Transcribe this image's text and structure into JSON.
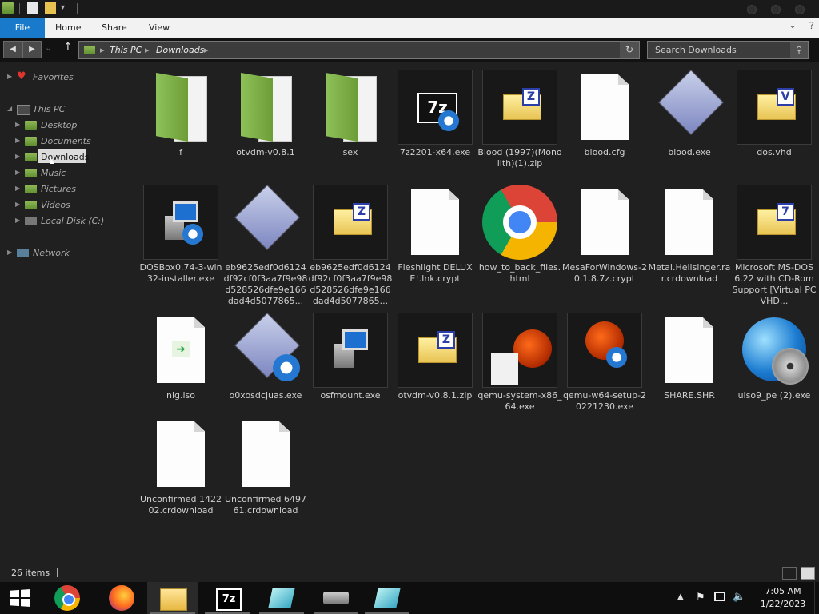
{
  "ribbon": {
    "file": "File",
    "home": "Home",
    "share": "Share",
    "view": "View"
  },
  "address": {
    "this_pc": "This PC",
    "downloads": "Downloads",
    "search_placeholder": "Search Downloads"
  },
  "sidebar": {
    "favorites": "Favorites",
    "this_pc": "This PC",
    "items": [
      "Desktop",
      "Documents",
      "Downloads",
      "Music",
      "Pictures",
      "Videos",
      "Local Disk (C:)"
    ],
    "network": "Network"
  },
  "files": [
    {
      "name": "f",
      "icon": "green-folder"
    },
    {
      "name": "otvdm-v0.8.1",
      "icon": "green-folder"
    },
    {
      "name": "sex",
      "icon": "green-folder"
    },
    {
      "name": "7z2201-x64.exe",
      "icon": "7zip-installer"
    },
    {
      "name": "Blood (1997)(Monolith)(1).zip",
      "icon": "zip-archive"
    },
    {
      "name": "blood.cfg",
      "icon": "blank-file"
    },
    {
      "name": "blood.exe",
      "icon": "exe-diamond"
    },
    {
      "name": "dos.vhd",
      "icon": "vhd-file"
    },
    {
      "name": "DOSBox0.74-3-win32-installer.exe",
      "icon": "installer"
    },
    {
      "name": "eb9625edf0d6124df92cf0f3aa7f9e98d528526dfe9e166dad4d5077865...",
      "icon": "exe-diamond"
    },
    {
      "name": "eb9625edf0d6124df92cf0f3aa7f9e98d528526dfe9e166dad4d5077865...",
      "icon": "zip-archive"
    },
    {
      "name": "Fleshlight DELUXE!.lnk.crypt",
      "icon": "blank-file"
    },
    {
      "name": "how_to_back_files.html",
      "icon": "chrome-html"
    },
    {
      "name": "MesaForWindows-20.1.8.7z.crypt",
      "icon": "blank-file"
    },
    {
      "name": "Metal.Hellsinger.rar.crdownload",
      "icon": "blank-file"
    },
    {
      "name": "Microsoft MS-DOS 6.22 with CD-Rom Support [Virtual PC VHD...",
      "icon": "7z-archive"
    },
    {
      "name": "nig.iso",
      "icon": "iso-file"
    },
    {
      "name": "o0xosdcjuas.exe",
      "icon": "exe-diamond-gear"
    },
    {
      "name": "osfmount.exe",
      "icon": "installer"
    },
    {
      "name": "otvdm-v0.8.1.zip",
      "icon": "zip-archive"
    },
    {
      "name": "qemu-system-x86_64.exe",
      "icon": "qemu"
    },
    {
      "name": "qemu-w64-setup-20221230.exe",
      "icon": "qemu-setup"
    },
    {
      "name": "SHARE.SHR",
      "icon": "blank-file"
    },
    {
      "name": "uiso9_pe (2).exe",
      "icon": "globe-disc"
    },
    {
      "name": "Unconfirmed 142202.crdownload",
      "icon": "blank-file"
    },
    {
      "name": "Unconfirmed 649761.crdownload",
      "icon": "blank-file"
    }
  ],
  "status": {
    "items": "26 items"
  },
  "tray": {
    "time": "7:05 AM",
    "date": "1/22/2023"
  },
  "colors": {
    "accent": "#1979ca",
    "folder_green": "#7fb04a"
  }
}
